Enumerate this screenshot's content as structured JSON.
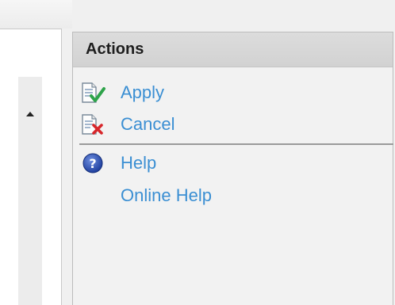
{
  "actions_panel": {
    "title": "Actions",
    "items": [
      {
        "label": "Apply",
        "icon": "apply-icon"
      },
      {
        "label": "Cancel",
        "icon": "cancel-icon"
      },
      {
        "label": "Help",
        "icon": "help-icon"
      },
      {
        "label": "Online Help",
        "icon": ""
      }
    ]
  },
  "colors": {
    "link": "#3b8fd3",
    "header_bg": "#d6d6d6"
  }
}
